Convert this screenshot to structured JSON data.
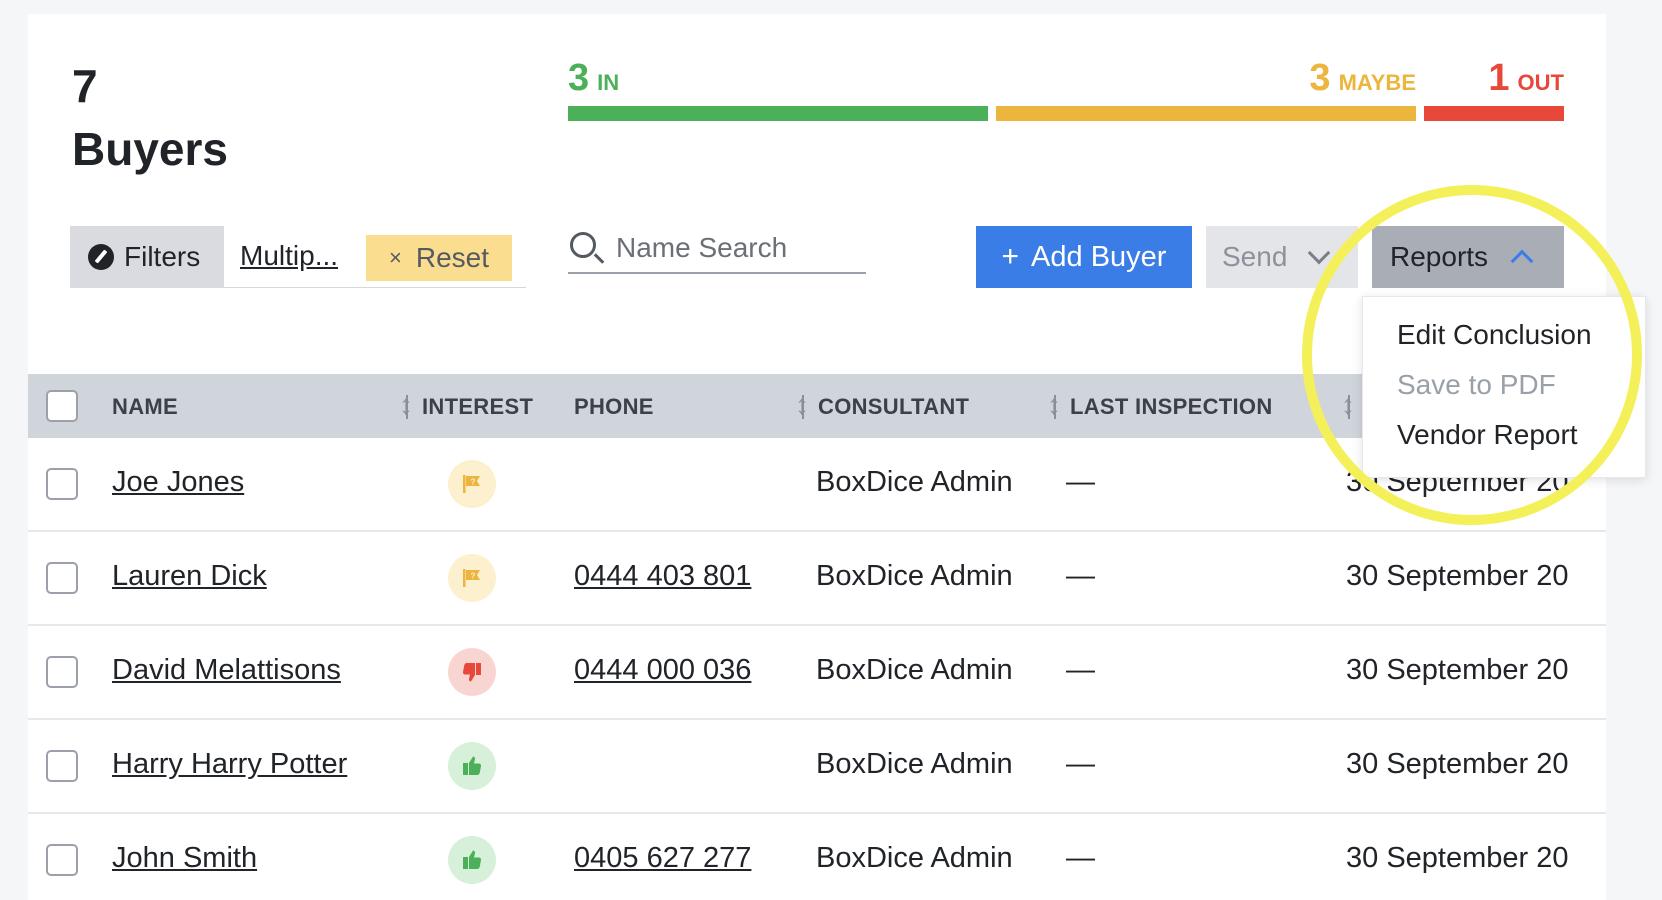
{
  "summary": {
    "count": "7",
    "label": "Buyers"
  },
  "interest_bar": {
    "in": {
      "count": "3",
      "label": "IN",
      "color": "#4cb05a",
      "value": 3
    },
    "maybe": {
      "count": "3",
      "label": "MAYBE",
      "color": "#ecb53d",
      "value": 3
    },
    "out": {
      "count": "1",
      "label": "OUT",
      "color": "#e8483a",
      "value": 1
    }
  },
  "toolbar": {
    "filters_label": "Filters",
    "filter_value": "Multip...",
    "reset_label": "Reset",
    "reset_icon": "×",
    "search_placeholder": "Name Search",
    "add_buyer_label": "Add Buyer",
    "add_icon": "+",
    "send_label": "Send",
    "reports_label": "Reports"
  },
  "table": {
    "headers": {
      "name": "NAME",
      "interest": "INTEREST",
      "phone": "PHONE",
      "consultant": "CONSULTANT",
      "last_inspection": "LAST INSPECTION"
    },
    "rows": [
      {
        "name": "Joe Jones",
        "interest": "maybe",
        "phone": "",
        "consultant": "BoxDice Admin",
        "last_inspection": "—",
        "date": "30 September 20"
      },
      {
        "name": "Lauren Dick",
        "interest": "maybe",
        "phone": "0444 403 801",
        "consultant": "BoxDice Admin",
        "last_inspection": "—",
        "date": "30 September 20"
      },
      {
        "name": "David Melattisons",
        "interest": "out",
        "phone": "0444 000 036",
        "consultant": "BoxDice Admin",
        "last_inspection": "—",
        "date": "30 September 20"
      },
      {
        "name": "Harry Harry Potter",
        "interest": "in",
        "phone": "",
        "consultant": "BoxDice Admin",
        "last_inspection": "—",
        "date": "30 September 20"
      },
      {
        "name": "John Smith",
        "interest": "in",
        "phone": "0405 627 277",
        "consultant": "BoxDice Admin",
        "last_inspection": "—",
        "date": "30 September 20"
      }
    ]
  },
  "reports_menu": {
    "items": [
      {
        "label": "Edit Conclusion",
        "enabled": true
      },
      {
        "label": "Save to PDF",
        "enabled": false
      },
      {
        "label": "Vendor Report",
        "enabled": true
      }
    ]
  },
  "colors": {
    "primary_button": "#3a7de6",
    "reset_chip": "#fbdd8f",
    "highlight_circle": "#f4f05a",
    "table_header": "#d0d4db"
  },
  "icons": {
    "filters": "edit-circle-icon",
    "search": "search-icon",
    "maybe": "flag-question-icon",
    "out": "thumbs-down-icon",
    "in": "thumbs-up-icon",
    "send_chevron": "chevron-down-icon",
    "reports_chevron": "chevron-up-icon"
  }
}
